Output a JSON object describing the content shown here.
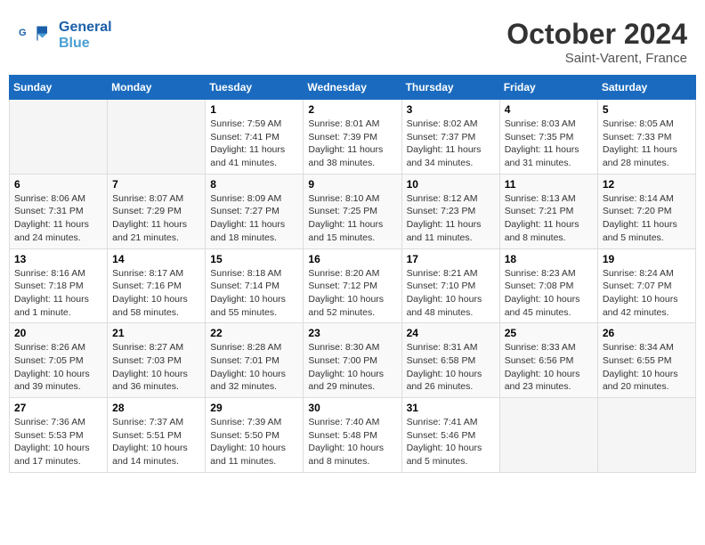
{
  "header": {
    "logo_line1": "General",
    "logo_line2": "Blue",
    "month": "October 2024",
    "location": "Saint-Varent, France"
  },
  "weekdays": [
    "Sunday",
    "Monday",
    "Tuesday",
    "Wednesday",
    "Thursday",
    "Friday",
    "Saturday"
  ],
  "weeks": [
    [
      {
        "day": "",
        "info": ""
      },
      {
        "day": "",
        "info": ""
      },
      {
        "day": "1",
        "info": "Sunrise: 7:59 AM\nSunset: 7:41 PM\nDaylight: 11 hours and 41 minutes."
      },
      {
        "day": "2",
        "info": "Sunrise: 8:01 AM\nSunset: 7:39 PM\nDaylight: 11 hours and 38 minutes."
      },
      {
        "day": "3",
        "info": "Sunrise: 8:02 AM\nSunset: 7:37 PM\nDaylight: 11 hours and 34 minutes."
      },
      {
        "day": "4",
        "info": "Sunrise: 8:03 AM\nSunset: 7:35 PM\nDaylight: 11 hours and 31 minutes."
      },
      {
        "day": "5",
        "info": "Sunrise: 8:05 AM\nSunset: 7:33 PM\nDaylight: 11 hours and 28 minutes."
      }
    ],
    [
      {
        "day": "6",
        "info": "Sunrise: 8:06 AM\nSunset: 7:31 PM\nDaylight: 11 hours and 24 minutes."
      },
      {
        "day": "7",
        "info": "Sunrise: 8:07 AM\nSunset: 7:29 PM\nDaylight: 11 hours and 21 minutes."
      },
      {
        "day": "8",
        "info": "Sunrise: 8:09 AM\nSunset: 7:27 PM\nDaylight: 11 hours and 18 minutes."
      },
      {
        "day": "9",
        "info": "Sunrise: 8:10 AM\nSunset: 7:25 PM\nDaylight: 11 hours and 15 minutes."
      },
      {
        "day": "10",
        "info": "Sunrise: 8:12 AM\nSunset: 7:23 PM\nDaylight: 11 hours and 11 minutes."
      },
      {
        "day": "11",
        "info": "Sunrise: 8:13 AM\nSunset: 7:21 PM\nDaylight: 11 hours and 8 minutes."
      },
      {
        "day": "12",
        "info": "Sunrise: 8:14 AM\nSunset: 7:20 PM\nDaylight: 11 hours and 5 minutes."
      }
    ],
    [
      {
        "day": "13",
        "info": "Sunrise: 8:16 AM\nSunset: 7:18 PM\nDaylight: 11 hours and 1 minute."
      },
      {
        "day": "14",
        "info": "Sunrise: 8:17 AM\nSunset: 7:16 PM\nDaylight: 10 hours and 58 minutes."
      },
      {
        "day": "15",
        "info": "Sunrise: 8:18 AM\nSunset: 7:14 PM\nDaylight: 10 hours and 55 minutes."
      },
      {
        "day": "16",
        "info": "Sunrise: 8:20 AM\nSunset: 7:12 PM\nDaylight: 10 hours and 52 minutes."
      },
      {
        "day": "17",
        "info": "Sunrise: 8:21 AM\nSunset: 7:10 PM\nDaylight: 10 hours and 48 minutes."
      },
      {
        "day": "18",
        "info": "Sunrise: 8:23 AM\nSunset: 7:08 PM\nDaylight: 10 hours and 45 minutes."
      },
      {
        "day": "19",
        "info": "Sunrise: 8:24 AM\nSunset: 7:07 PM\nDaylight: 10 hours and 42 minutes."
      }
    ],
    [
      {
        "day": "20",
        "info": "Sunrise: 8:26 AM\nSunset: 7:05 PM\nDaylight: 10 hours and 39 minutes."
      },
      {
        "day": "21",
        "info": "Sunrise: 8:27 AM\nSunset: 7:03 PM\nDaylight: 10 hours and 36 minutes."
      },
      {
        "day": "22",
        "info": "Sunrise: 8:28 AM\nSunset: 7:01 PM\nDaylight: 10 hours and 32 minutes."
      },
      {
        "day": "23",
        "info": "Sunrise: 8:30 AM\nSunset: 7:00 PM\nDaylight: 10 hours and 29 minutes."
      },
      {
        "day": "24",
        "info": "Sunrise: 8:31 AM\nSunset: 6:58 PM\nDaylight: 10 hours and 26 minutes."
      },
      {
        "day": "25",
        "info": "Sunrise: 8:33 AM\nSunset: 6:56 PM\nDaylight: 10 hours and 23 minutes."
      },
      {
        "day": "26",
        "info": "Sunrise: 8:34 AM\nSunset: 6:55 PM\nDaylight: 10 hours and 20 minutes."
      }
    ],
    [
      {
        "day": "27",
        "info": "Sunrise: 7:36 AM\nSunset: 5:53 PM\nDaylight: 10 hours and 17 minutes."
      },
      {
        "day": "28",
        "info": "Sunrise: 7:37 AM\nSunset: 5:51 PM\nDaylight: 10 hours and 14 minutes."
      },
      {
        "day": "29",
        "info": "Sunrise: 7:39 AM\nSunset: 5:50 PM\nDaylight: 10 hours and 11 minutes."
      },
      {
        "day": "30",
        "info": "Sunrise: 7:40 AM\nSunset: 5:48 PM\nDaylight: 10 hours and 8 minutes."
      },
      {
        "day": "31",
        "info": "Sunrise: 7:41 AM\nSunset: 5:46 PM\nDaylight: 10 hours and 5 minutes."
      },
      {
        "day": "",
        "info": ""
      },
      {
        "day": "",
        "info": ""
      }
    ]
  ]
}
